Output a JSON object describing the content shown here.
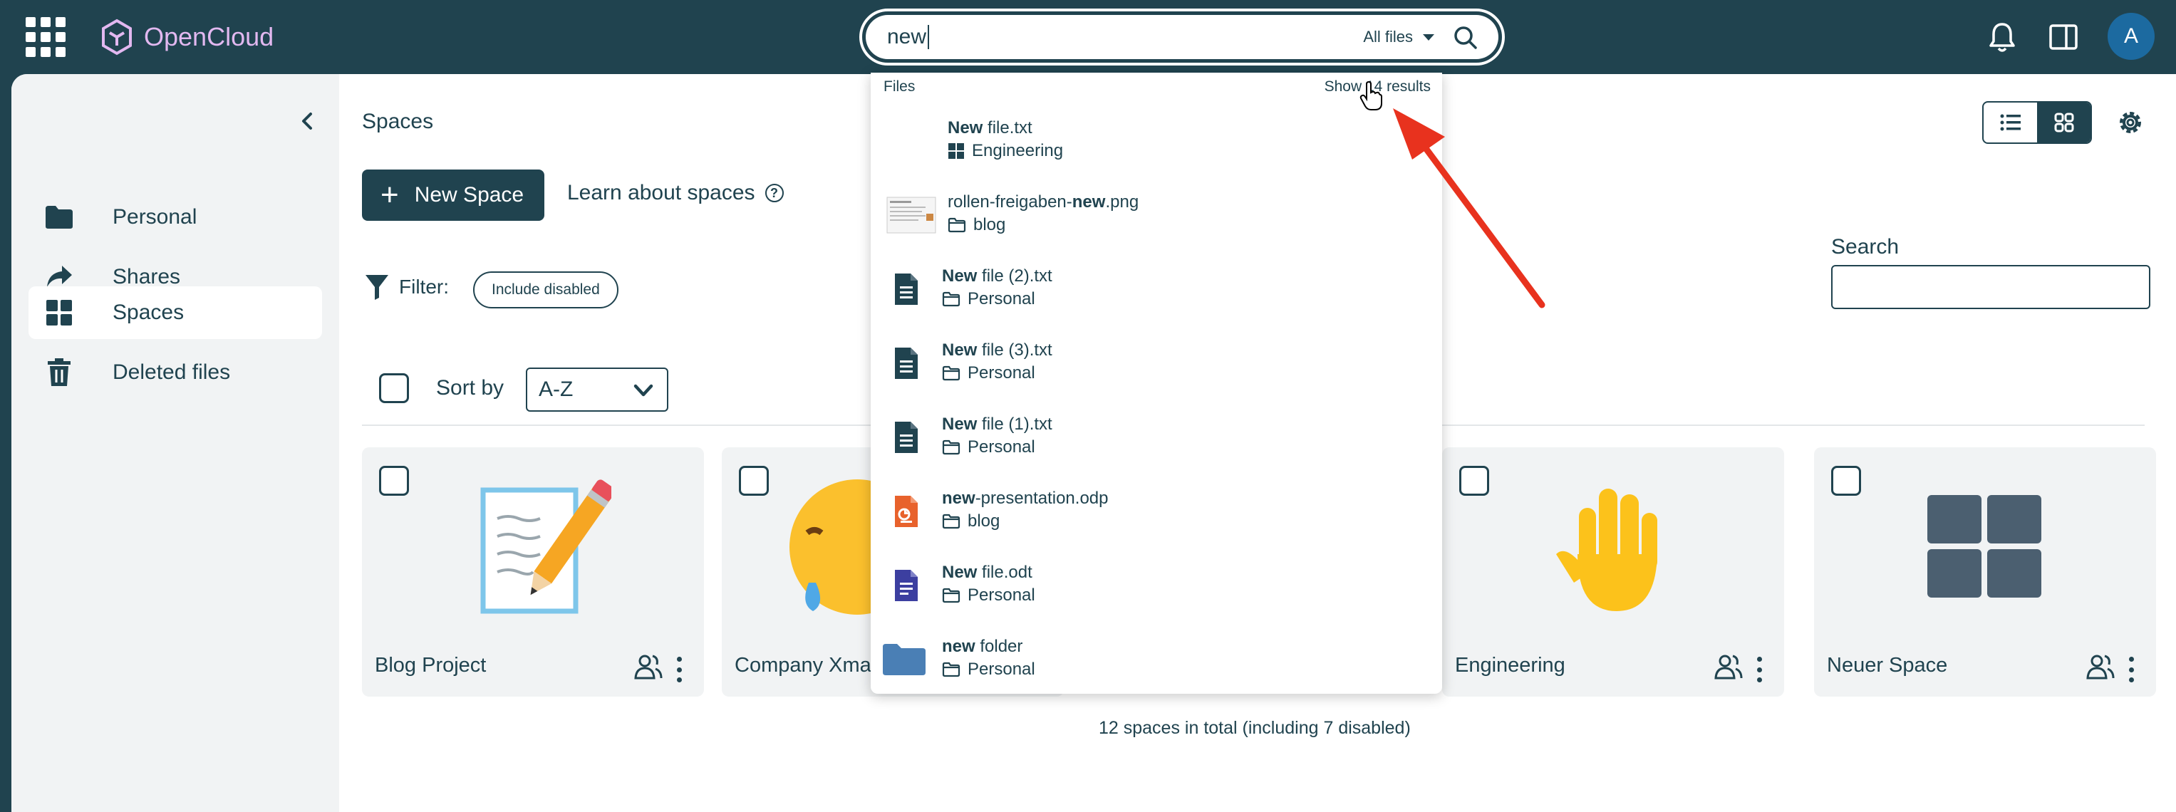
{
  "app": {
    "name": "OpenCloud"
  },
  "search": {
    "query": "new",
    "scope": "All files"
  },
  "user": {
    "initial": "A"
  },
  "sidebar": {
    "items": [
      {
        "label": "Personal",
        "icon": "folder-icon"
      },
      {
        "label": "Shares",
        "icon": "share-arrow-icon"
      },
      {
        "label": "Spaces",
        "icon": "grid-icon",
        "active": true
      },
      {
        "label": "Deleted files",
        "icon": "trash-icon"
      }
    ]
  },
  "page": {
    "title": "Spaces",
    "new_space_label": "New Space",
    "learn_label": "Learn about spaces",
    "filter_label": "Filter:",
    "filter_chip": "Include disabled",
    "sort_label": "Sort by",
    "sort_value": "A-Z",
    "search_label": "Search",
    "total": "12 spaces in total (including 7 disabled)"
  },
  "spaces": [
    {
      "name": "Blog Project",
      "thumb": "memo-pencil-emoji"
    },
    {
      "name": "Company Xmas",
      "thumb": "crying-face-emoji"
    },
    {
      "name": "Engineering",
      "thumb": "raised-hand-emoji"
    },
    {
      "name": "Neuer Space",
      "thumb": "grid-icon"
    }
  ],
  "dropdown": {
    "header": "Files",
    "show_results": "Show 14 results",
    "results": [
      {
        "bold": "New",
        "pre": "",
        "rest": " file.txt",
        "location": "Engineering",
        "loc_icon": "space-grid-icon",
        "icon": "none"
      },
      {
        "bold": "new",
        "pre": "rollen-freigaben-",
        "rest": ".png",
        "location": "blog",
        "loc_icon": "folder-outline-icon",
        "icon": "image-thumbnail"
      },
      {
        "bold": "New",
        "pre": "",
        "rest": " file (2).txt",
        "location": "Personal",
        "loc_icon": "folder-outline-icon",
        "icon": "text-file-icon"
      },
      {
        "bold": "New",
        "pre": "",
        "rest": " file (3).txt",
        "location": "Personal",
        "loc_icon": "folder-outline-icon",
        "icon": "text-file-icon"
      },
      {
        "bold": "New",
        "pre": "",
        "rest": " file (1).txt",
        "location": "Personal",
        "loc_icon": "folder-outline-icon",
        "icon": "text-file-icon"
      },
      {
        "bold": "new",
        "pre": "",
        "rest": "-presentation.odp",
        "location": "blog",
        "loc_icon": "folder-outline-icon",
        "icon": "presentation-file-icon"
      },
      {
        "bold": "New",
        "pre": "",
        "rest": " file.odt",
        "location": "Personal",
        "loc_icon": "folder-outline-icon",
        "icon": "document-file-icon"
      },
      {
        "bold": "new",
        "pre": "",
        "rest": " folder",
        "location": "Personal",
        "loc_icon": "folder-outline-icon",
        "icon": "folder-icon"
      }
    ]
  },
  "colors": {
    "primary": "#20434f",
    "logo": "#e2b8f0",
    "avatar": "#1c6aa0",
    "annotation": "#e8321e"
  }
}
